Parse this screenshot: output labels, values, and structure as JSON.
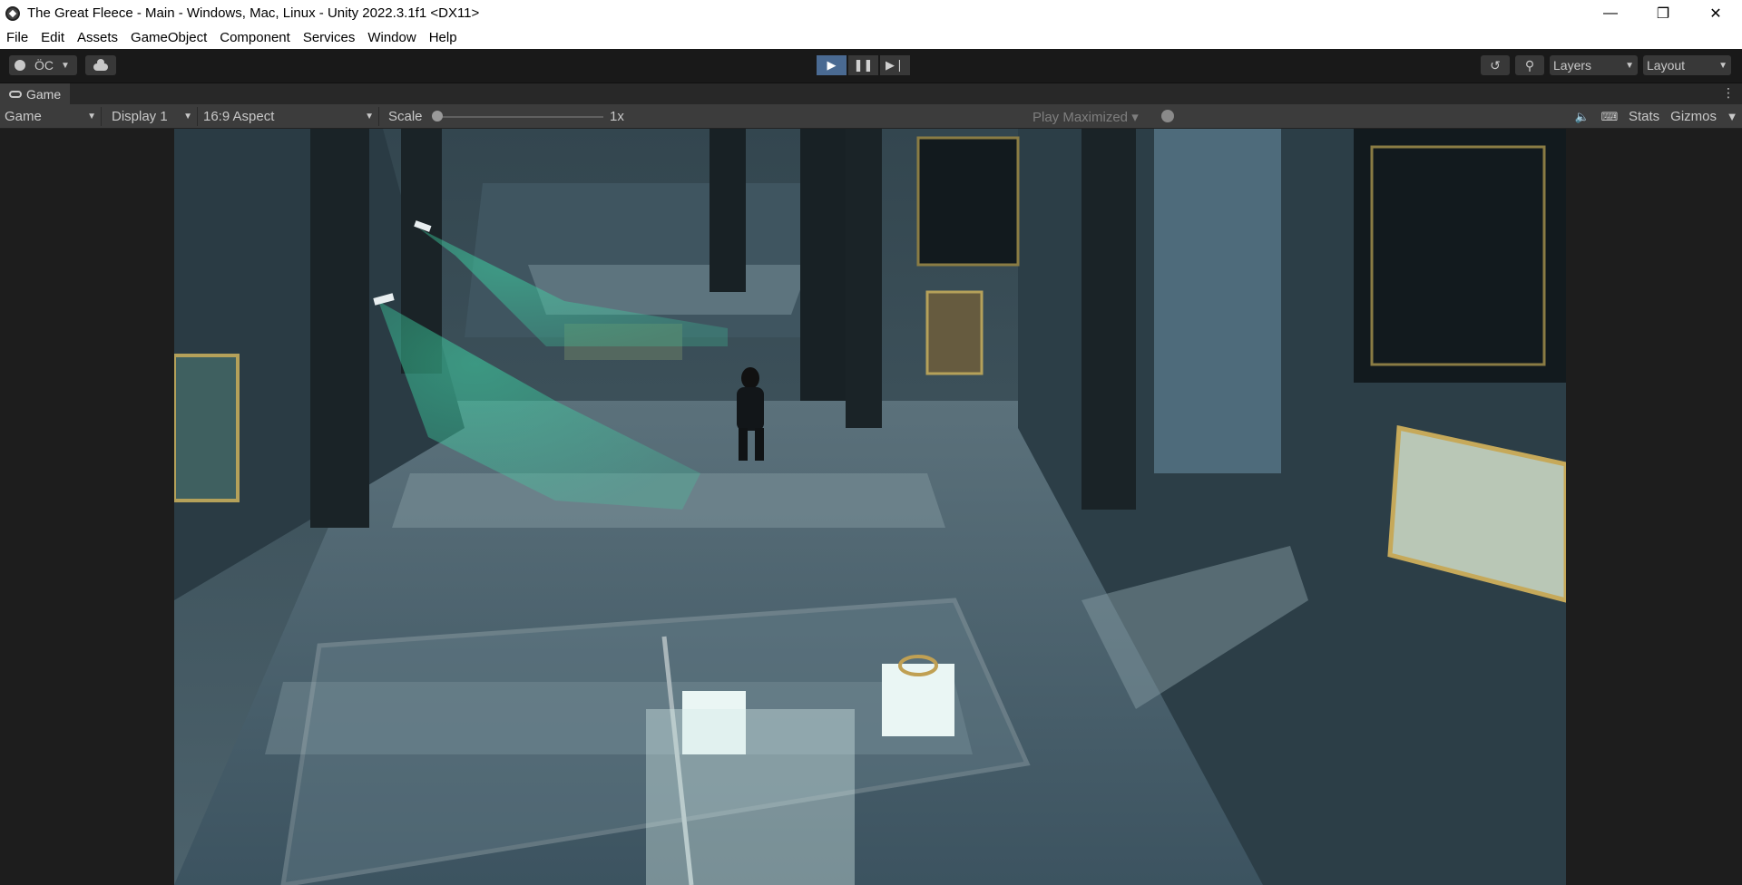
{
  "window": {
    "title": "The Great Fleece - Main - Windows, Mac, Linux - Unity 2022.3.1f1 <DX11>",
    "minimize_glyph": "—",
    "maximize_glyph": "❐",
    "close_glyph": "✕"
  },
  "menu": {
    "items": [
      "File",
      "Edit",
      "Assets",
      "GameObject",
      "Component",
      "Services",
      "Window",
      "Help"
    ]
  },
  "toolbar": {
    "account_label": "ÖC",
    "layers_label": "Layers",
    "layout_label": "Layout"
  },
  "game_tab": {
    "label": "Game"
  },
  "game_toolbar": {
    "view_mode": "Game",
    "display": "Display 1",
    "aspect": "16:9 Aspect",
    "scale_label": "Scale",
    "scale_value": "1x",
    "play_mode": "Play Maximized",
    "stats_label": "Stats",
    "gizmos_label": "Gizmos"
  },
  "colors": {
    "play_active": "#4a6a92",
    "editor_bg": "#191919",
    "panel_bg": "#3c3c3c"
  }
}
